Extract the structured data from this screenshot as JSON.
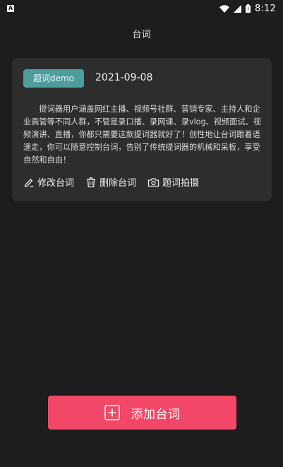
{
  "status_bar": {
    "app_badge": "A",
    "time": "8:12"
  },
  "header": {
    "title": "台词"
  },
  "script_card": {
    "tag_label": "题词demo",
    "date": "2021-09-08",
    "description": "提词器用户涵盖网红主播、视频号社群、营销专家、主持人和企业高管等不同人群，不管是录口播、录网课、录vlog、视频面试、视频演讲、直播，你都只需要这款提词器就好了！创性地让台词跟着语速走，你可以随意控制台词，告别了传统提词器的机械和呆板，享受自然和自由！",
    "actions": {
      "edit_label": "修改台词",
      "delete_label": "删除台词",
      "shoot_label": "题词拍摄"
    }
  },
  "footer": {
    "add_label": "添加台词"
  },
  "colors": {
    "background": "#1d1d1d",
    "card": "#2c2d2d",
    "tag": "#4f9c9c",
    "accent": "#f24766"
  },
  "icons": [
    "wifi-icon",
    "signal-icon",
    "battery-icon",
    "edit-icon",
    "trash-icon",
    "camera-icon",
    "plus-square-icon"
  ]
}
